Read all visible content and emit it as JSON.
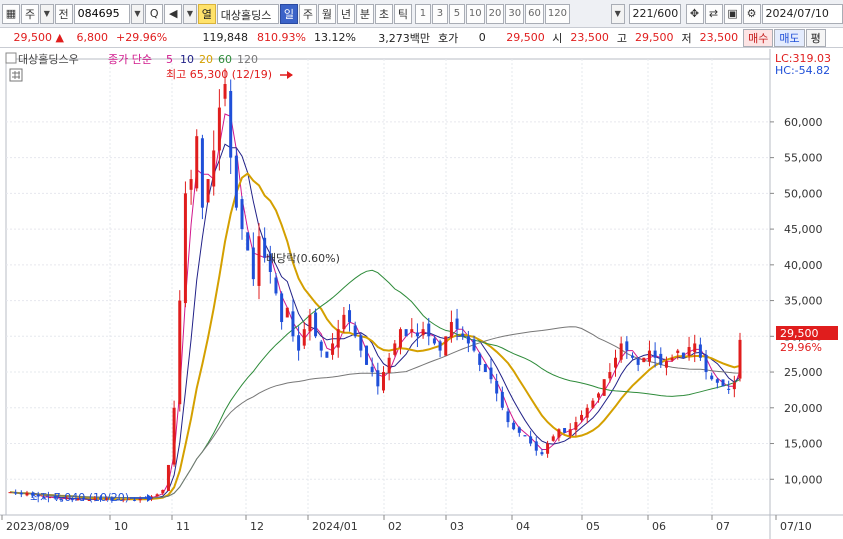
{
  "toolbar": {
    "mode_label": "주",
    "jeon_label": "전",
    "code": "084695",
    "yeol_label": "열",
    "stock_name": "대상홀딩스",
    "period_tabs": [
      "일",
      "주",
      "월",
      "년",
      "분",
      "초",
      "틱"
    ],
    "active_period": "일",
    "interval_tabs": [
      "1",
      "3",
      "5",
      "10",
      "20",
      "30",
      "60",
      "120"
    ],
    "count": "221/600",
    "date": "2024/07/10"
  },
  "quote": {
    "price": "29,500",
    "change": "6,800",
    "change_pct": "+29.96%",
    "volume": "119,848",
    "volume_pct": "810.93%",
    "turnover": "13.12%",
    "amount": "3,273백만",
    "hoga_label": "호가",
    "hoga_value": "0",
    "hoga_price": "29,500",
    "open_label": "시",
    "open": "23,500",
    "high_label": "고",
    "high": "29,500",
    "low_label": "저",
    "low": "23,500",
    "buy_label": "매수",
    "sell_label": "매도",
    "eval_label": "평"
  },
  "legend": {
    "name": "대상홀딩스우",
    "ma_label": "종가 단순",
    "periods": [
      "5",
      "10",
      "20",
      "60",
      "120"
    ],
    "period_colors": [
      "#d1188c",
      "#222288",
      "#d4a000",
      "#2e8b3a",
      "#777777"
    ],
    "lc": "LC:319.03",
    "hc": "HC:-54.82"
  },
  "annotations": {
    "high": "최고 65,300 (12/19)",
    "low": "최저 7,040 (10/20)",
    "ex_rights": "배당락(0.60%)"
  },
  "price_tag": {
    "value": "29,500",
    "pct": "29.96%"
  },
  "colors": {
    "up": "#e01d1d",
    "down": "#1f4fd8",
    "ma5": "#d1188c",
    "ma10": "#222288",
    "ma20": "#d4a000",
    "ma60": "#2e8b3a",
    "ma120": "#777777"
  },
  "chart_data": {
    "type": "candlestick",
    "y_axis": {
      "ticks": [
        "60,000",
        "55,000",
        "50,000",
        "45,000",
        "40,000",
        "35,000",
        "30,000",
        "25,000",
        "20,000",
        "15,000",
        "10,000"
      ],
      "range": [
        5000,
        65300
      ]
    },
    "x_axis": {
      "labels": [
        "2023/08/09",
        "10",
        "11",
        "12",
        "2024/01",
        "02",
        "03",
        "04",
        "05",
        "06",
        "07",
        "07/10"
      ]
    },
    "closes": [
      8200,
      8000,
      7900,
      8100,
      7700,
      7600,
      7400,
      7500,
      7300,
      7200,
      7400,
      7100,
      7300,
      7200,
      7100,
      7300,
      7200,
      7400,
      7000,
      7100,
      7200,
      7300,
      7100,
      7300,
      7400,
      7600,
      7900,
      8500,
      12000,
      20000,
      35000,
      50000,
      52000,
      58000,
      48000,
      52000,
      56000,
      62000,
      65300,
      55000,
      48000,
      45000,
      42000,
      38000,
      44000,
      41000,
      39000,
      36000,
      32000,
      34000,
      30000,
      28000,
      31000,
      33000,
      30000,
      28000,
      27000,
      29000,
      31000,
      33000,
      32000,
      30000,
      28000,
      26000,
      25000,
      23000,
      25000,
      27000,
      29000,
      31000,
      30000,
      31000,
      30000,
      31000,
      30000,
      29000,
      28000,
      30000,
      32000,
      31000,
      30000,
      29000,
      28000,
      26000,
      25000,
      24000,
      22000,
      20000,
      18000,
      17000,
      16500,
      16000,
      15000,
      14000,
      13500,
      15000,
      16000,
      17000,
      16500,
      17000,
      18000,
      19000,
      20000,
      21000,
      22000,
      24000,
      25000,
      27000,
      29000,
      28000,
      27000,
      26000,
      27000,
      28000,
      27000,
      26000,
      26500,
      27000,
      28000,
      27000,
      28500,
      29000,
      27000,
      25000,
      24000,
      23500,
      23000,
      22500,
      23500,
      29500
    ]
  }
}
